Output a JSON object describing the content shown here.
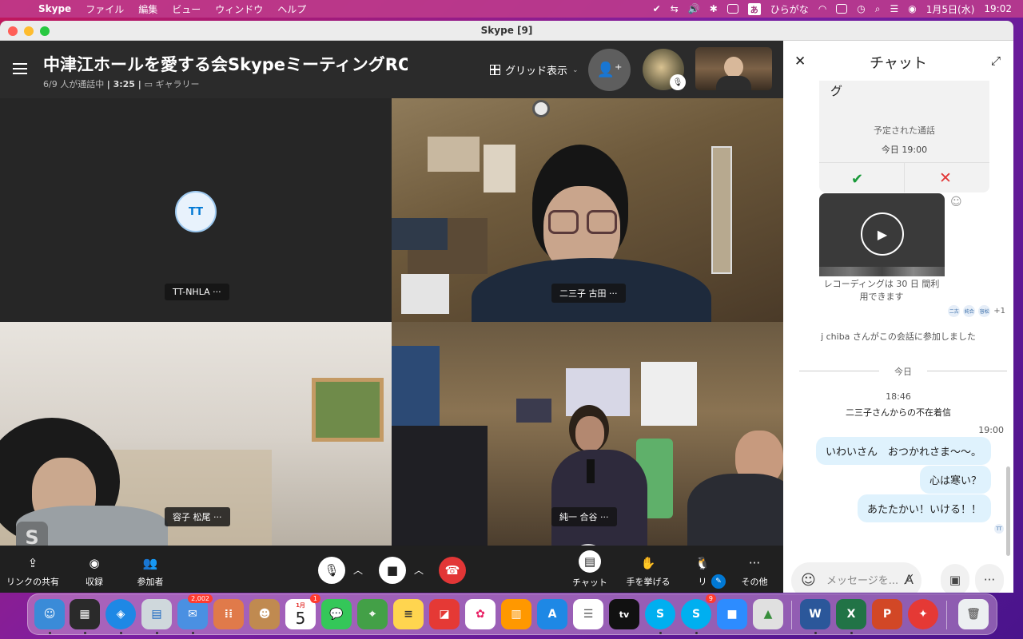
{
  "menubar": {
    "app": "Skype",
    "items": [
      "ファイル",
      "編集",
      "ビュー",
      "ウィンドウ",
      "ヘルプ"
    ],
    "battery": "",
    "ime": "あ",
    "ime_label": "ひらがな",
    "date": "1月5日(水)",
    "time": "19:02"
  },
  "window": {
    "title": "Skype [9]"
  },
  "call": {
    "title": "中津江ホールを愛する会SkypeミーティングROOM",
    "participants": "6/9 人が通話中",
    "duration": "3:25",
    "view_label": "ギャラリー",
    "grid_view": "グリッド表示"
  },
  "tiles": [
    {
      "label": "TT-NHLA",
      "initials": "TT"
    },
    {
      "label": "二三子 古田"
    },
    {
      "label": "容子 松尾",
      "overlay": "S"
    },
    {
      "label": "純一 合谷"
    }
  ],
  "tile_more": "···",
  "toolbar": {
    "share_link": "リンクの共有",
    "record": "収録",
    "participants": "参加者",
    "chat": "チャット",
    "raise_hand": "手を挙げる",
    "react": "リ",
    "more": "その他"
  },
  "chat": {
    "title": "チャット",
    "card_tail": "グ",
    "scheduled_call": "予定された通話",
    "scheduled_time": "今日 19:00",
    "recording_note": "レコーディングは 30 日 間利用できます",
    "seen_more": "+1",
    "seen_avatars": [
      "二古",
      "純合",
      "容松"
    ],
    "join_msg": "j chiba さんがこの会話に参加しました",
    "today": "今日",
    "time1": "18:46",
    "missed": "二三子さんからの不在着信",
    "time2": "19:00",
    "messages": [
      "いわいさん　おつかれさま〜〜。",
      "心は寒い？",
      "あたたかい！いける！！"
    ],
    "sender_initials": "TT",
    "placeholder": "メッセージを..."
  },
  "dock": {
    "mail_badge": "2,002",
    "cal_month": "1月",
    "cal_day": "5",
    "cal_badge": "1",
    "skype_badge": "9",
    "appletv": "tv"
  },
  "colors": {
    "skype_blue": "#0078d4",
    "end_call": "#e23636",
    "chat_bubble": "#dff2fd",
    "accept": "#1a9a3a"
  }
}
